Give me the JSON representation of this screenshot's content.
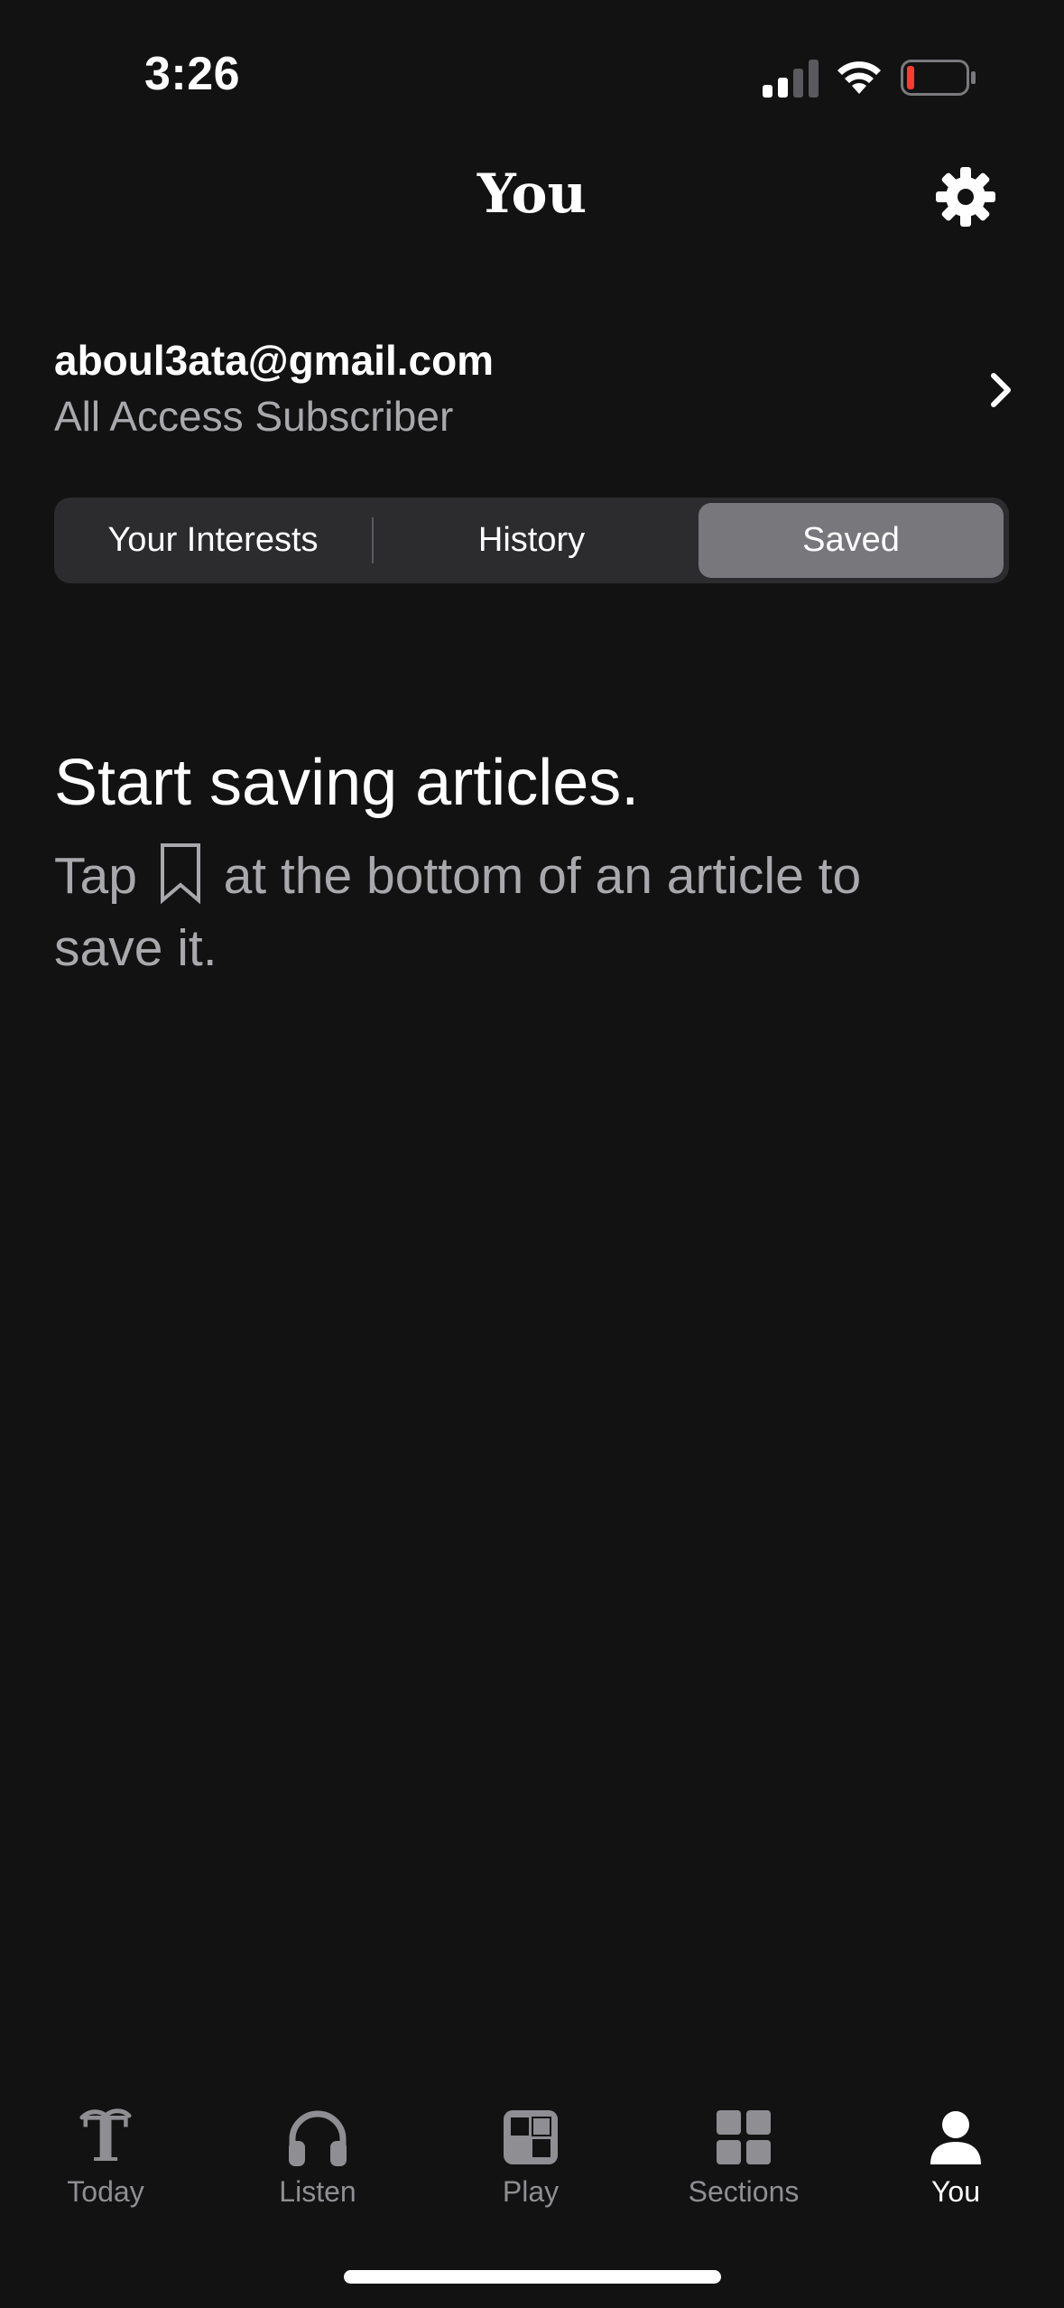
{
  "status_bar": {
    "time": "3:26"
  },
  "header": {
    "title": "You"
  },
  "account": {
    "email": "aboul3ata@gmail.com",
    "plan": "All Access Subscriber"
  },
  "segments": {
    "items": [
      {
        "label": "Your Interests",
        "selected": false
      },
      {
        "label": "History",
        "selected": false
      },
      {
        "label": "Saved",
        "selected": true
      }
    ]
  },
  "empty_state": {
    "title": "Start saving articles.",
    "text_before_icon": "Tap",
    "text_after_icon": "at the bottom of an article to save it."
  },
  "tab_bar": {
    "items": [
      {
        "label": "Today",
        "icon": "nyt-logo-icon",
        "active": false
      },
      {
        "label": "Listen",
        "icon": "headphones-icon",
        "active": false
      },
      {
        "label": "Play",
        "icon": "games-icon",
        "active": false
      },
      {
        "label": "Sections",
        "icon": "grid-icon",
        "active": false
      },
      {
        "label": "You",
        "icon": "person-icon",
        "active": true
      }
    ]
  },
  "colors": {
    "background": "#121212",
    "secondary_text": "#a9a9ad",
    "segment_background": "#2c2c2e",
    "segment_selected": "#77777c",
    "battery_low": "#ff3b30",
    "tab_inactive": "#8e8e93"
  }
}
